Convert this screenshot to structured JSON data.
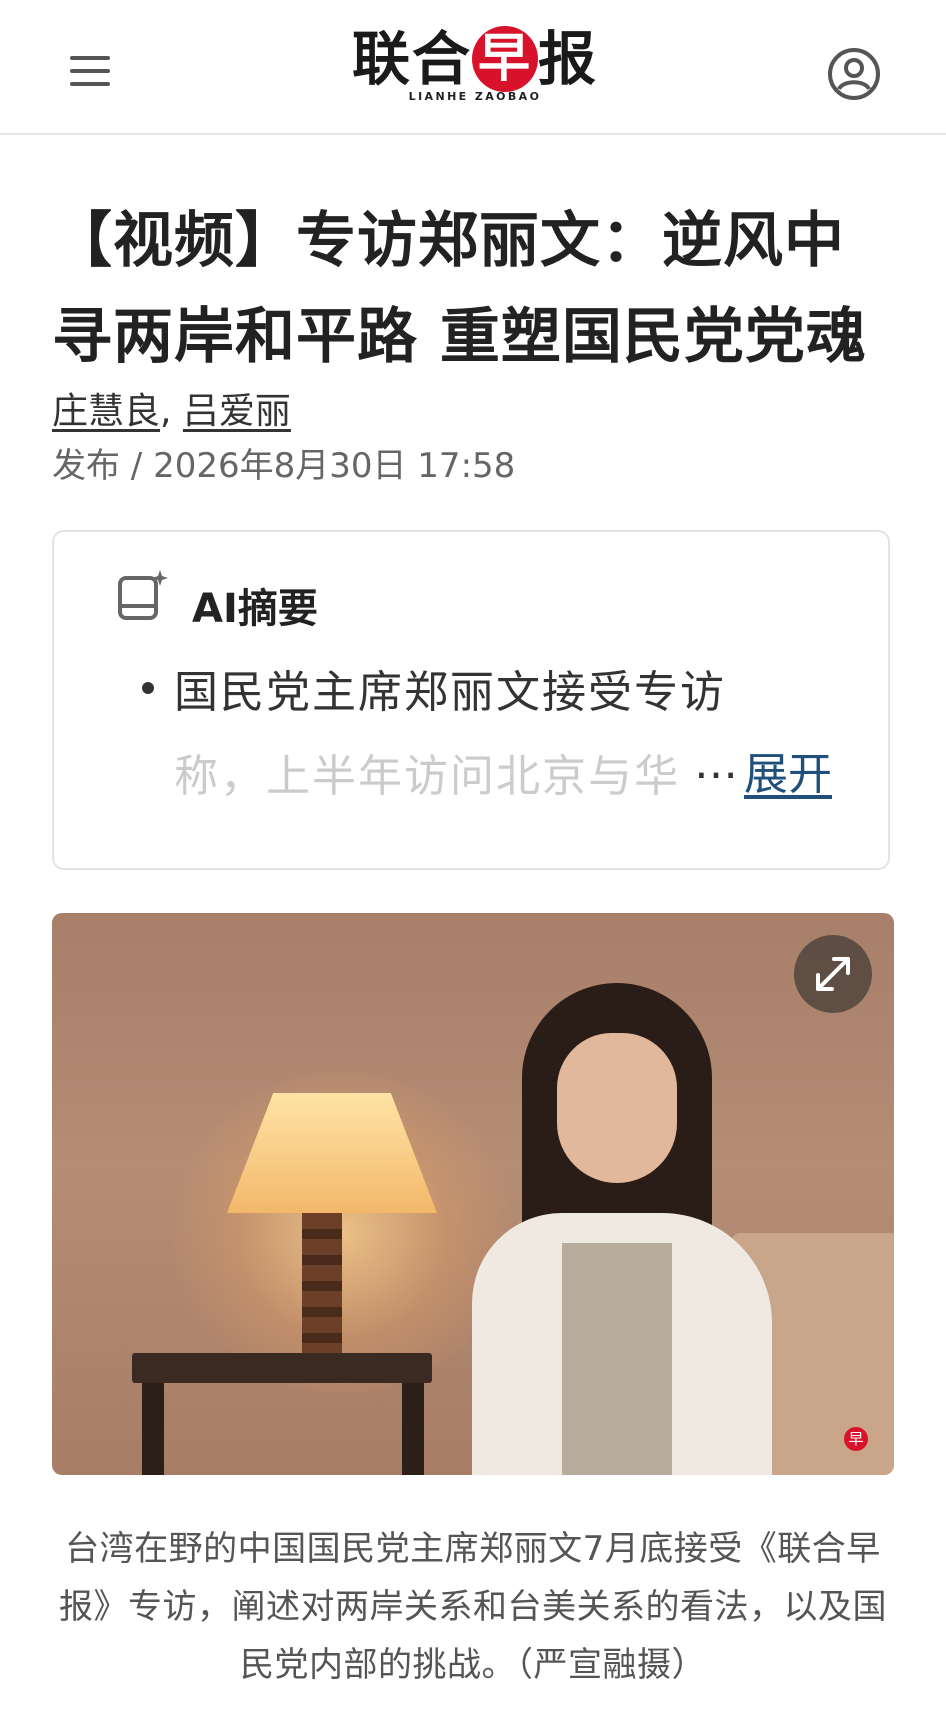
{
  "header": {
    "logo_cn_1": "联合",
    "logo_cn_red": "早",
    "logo_cn_2": "报",
    "logo_en": "LIANHE ZAOBAO",
    "menu_icon": "hamburger-menu-icon",
    "account_icon": "user-account-icon"
  },
  "article": {
    "title": "【视频】专访郑丽文：逆风中寻两岸和平路 重塑国民党党魂",
    "authors": [
      "庄慧良",
      "吕爱丽"
    ],
    "author_separator": ", ",
    "date": "发布 / 2026年8月30日 17:58"
  },
  "ai_summary": {
    "title": "AI摘要",
    "line1": "国民党主席郑丽文接受专访",
    "line2": "称，上半年访问北京与华",
    "ellipsis": "…",
    "expand_label": "展开"
  },
  "photo": {
    "expand_icon": "expand-fullscreen-icon",
    "watermark": "早"
  },
  "caption": "台湾在野的中国国民党主席郑丽文7月底接受《联合早报》专访，阐述对两岸关系和台美关系的看法，以及国民党内部的挑战。（严宣融摄）",
  "colors": {
    "brand_red": "#d8122a",
    "link_blue": "#1f4f7a"
  }
}
